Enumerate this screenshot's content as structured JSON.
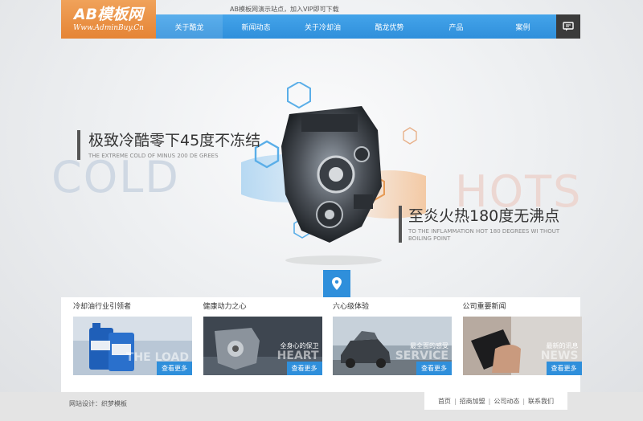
{
  "header": {
    "logo_text": "AB模板网",
    "logo_url": "Www.AdminBuy.Cn",
    "notice": "AB模板网演示站点，加入VIP即可下载"
  },
  "nav": {
    "items": [
      "关于酷龙",
      "新闻动态",
      "关于冷却油",
      "酷龙优势",
      "产品",
      "案例"
    ]
  },
  "hero": {
    "cold_cn": "极致冷酷零下45度不冻结",
    "cold_en": "THE EXTREME COLD OF MINUS 200 DE GREES",
    "cold_big": "COLD",
    "hot_cn": "至炎火热180度无沸点",
    "hot_en": "TO THE INFLAMMATION HOT 180 DEGREES WI THOUT BOILING POINT",
    "hot_big": "HOTS"
  },
  "cards": [
    {
      "title": "冷却油行业引领者",
      "tag_cn": "",
      "tag_en": "THE LOAD",
      "more": "查看更多"
    },
    {
      "title": "健康动力之心",
      "tag_cn": "全身心的保卫",
      "tag_en": "HEART",
      "more": "查看更多"
    },
    {
      "title": "六心级体验",
      "tag_cn": "最全面的感受",
      "tag_en": "SERVICE",
      "more": "查看更多"
    },
    {
      "title": "公司重要新闻",
      "tag_cn": "最新的讯息",
      "tag_en": "NEWS",
      "more": "查看更多"
    }
  ],
  "footer": {
    "design": "网站设计：织梦模板",
    "links": [
      "首页",
      "招商加盟",
      "公司动态",
      "联系我们"
    ]
  },
  "colors": {
    "accent_blue": "#2f8fdb",
    "logo_orange": "#e58435",
    "dark": "#3b3b3b"
  }
}
